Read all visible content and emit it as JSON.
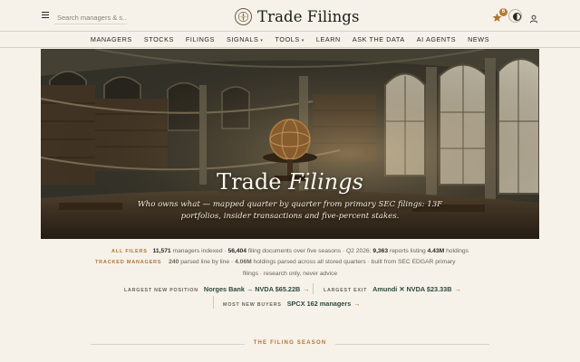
{
  "header": {
    "search_placeholder": "Search managers & s...",
    "logo_text": "Trade Filings",
    "notification_count": "6"
  },
  "nav": [
    {
      "label": "MANAGERS",
      "dropdown": false
    },
    {
      "label": "STOCKS",
      "dropdown": false
    },
    {
      "label": "FILINGS",
      "dropdown": false
    },
    {
      "label": "SIGNALS",
      "dropdown": true
    },
    {
      "label": "TOOLS",
      "dropdown": true
    },
    {
      "label": "LEARN",
      "dropdown": false
    },
    {
      "label": "ASK THE DATA",
      "dropdown": false
    },
    {
      "label": "AI AGENTS",
      "dropdown": false
    },
    {
      "label": "NEWS",
      "dropdown": false
    }
  ],
  "hero": {
    "title_plain": "Trade",
    "title_italic": "Filings",
    "subtitle": "Who owns what — mapped quarter by quarter from primary SEC filings: 13F portfolios, insider transactions and five-percent stakes."
  },
  "stats": {
    "all_filers_label": "ALL FILERS",
    "managers_indexed_count": "11,571",
    "managers_indexed_text": "managers indexed ·",
    "filing_docs_count": "56,404",
    "filing_docs_text": "filing documents over five seasons · Q2 2026:",
    "reports_count": "9,363",
    "reports_text": "reports listing",
    "holdings_count": "4.43M",
    "holdings_text": "holdings",
    "tracked_label": "TRACKED MANAGERS",
    "tracked_count": "240",
    "tracked_text": "parsed line by line ·",
    "tracked_holdings_count": "4.06M",
    "tracked_holdings_text": "holdings parsed across all stored quarters · built from SEC EDGAR primary",
    "tracked_tail": "filings · research only, never advice"
  },
  "movers": {
    "largest_new_label": "LARGEST NEW POSITION",
    "largest_new_value": "Norges Bank → NVDA  $65.22B",
    "largest_exit_label": "LARGEST EXIT",
    "largest_exit_value": "Amundi ✕ NVDA  $23.33B",
    "most_new_label": "MOST NEW BUYERS",
    "most_new_value": "SPCX  162 managers",
    "arrow": "→"
  },
  "section": {
    "filing_season": "THE FILING SEASON"
  },
  "colors": {
    "background": "#f6f2ea",
    "accent": "#b07433",
    "green_text": "#2d4a3a"
  }
}
